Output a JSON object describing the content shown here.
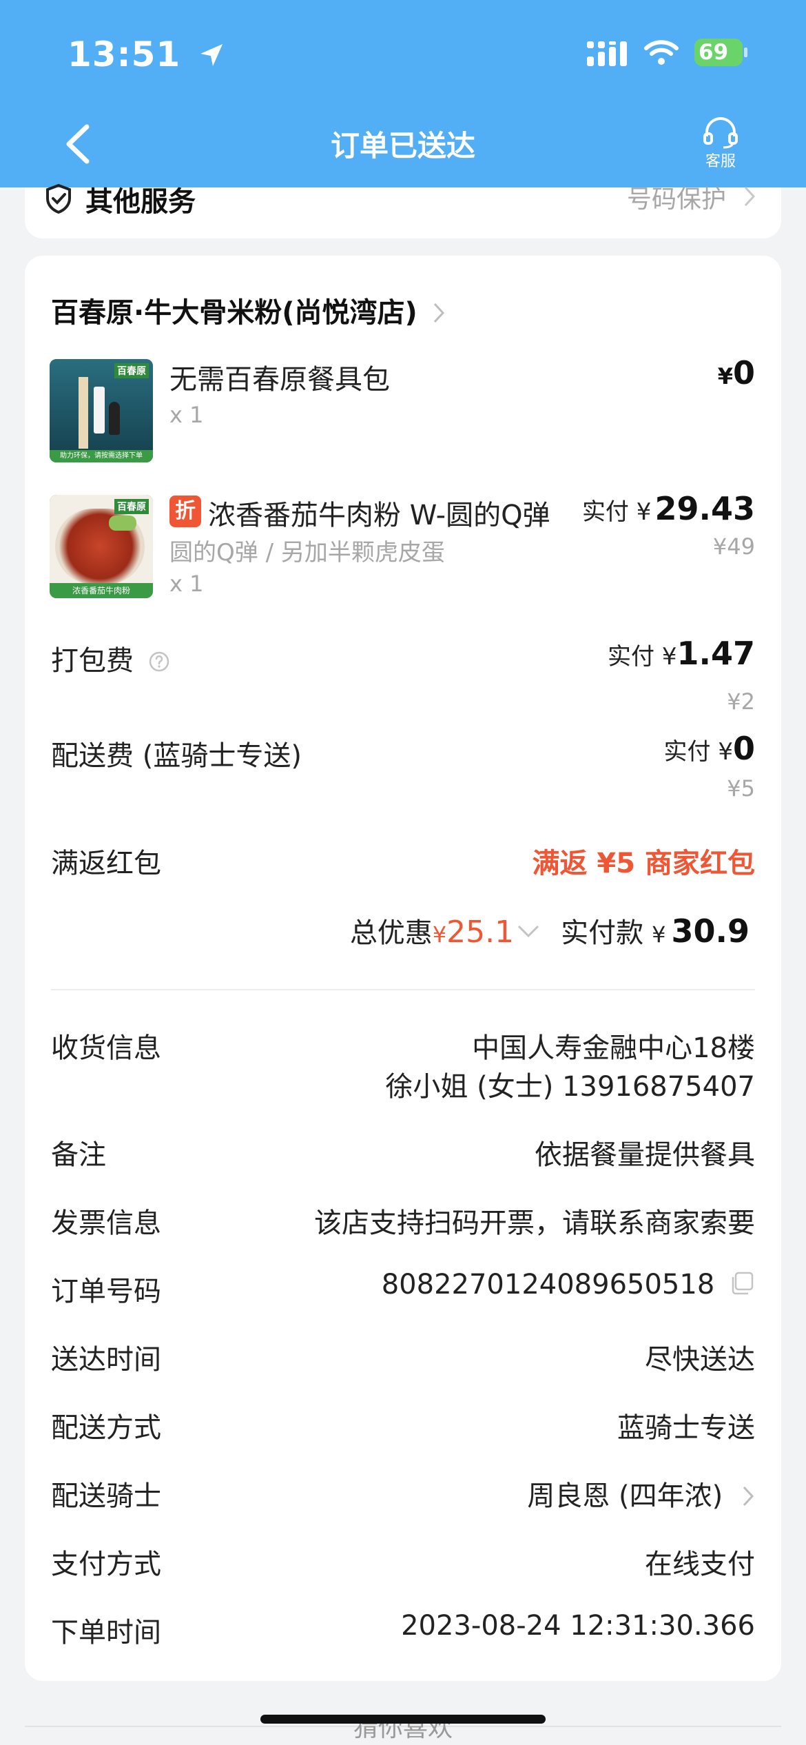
{
  "status": {
    "time": "13:51",
    "battery": "69"
  },
  "nav": {
    "title": "订单已送达",
    "service_label": "客服"
  },
  "other_services": {
    "label": "其他服务",
    "value": "号码保护"
  },
  "store": {
    "name": "百春原·牛大骨米粉(尚悦湾店)"
  },
  "items": [
    {
      "name": "无需百春原餐具包",
      "qty": "x 1",
      "price_symbol": "¥",
      "price": "0",
      "thumb_brand": "百春原",
      "thumb_caption": "助力环保，请按需选择下单"
    },
    {
      "badge": "折",
      "name": "浓香番茄牛肉粉 W-圆的Q弹",
      "spec": "圆的Q弹 / 另加半颗虎皮蛋",
      "qty": "x 1",
      "paid_prefix": "实付 ¥",
      "price": "29.43",
      "original": "¥49",
      "thumb_brand": "百春原",
      "thumb_caption": "浓香番茄牛肉粉"
    }
  ],
  "fees": {
    "packing": {
      "label": "打包费",
      "paid_prefix": "实付 ¥",
      "paid": "1.47",
      "original": "¥2"
    },
    "delivery": {
      "label": "配送费 (蓝骑士专送)",
      "paid_prefix": "实付 ¥",
      "paid": "0",
      "original": "¥5"
    },
    "redpack": {
      "label": "满返红包",
      "value": "满返 ¥5 商家红包"
    }
  },
  "totals": {
    "discount_label": "总优惠",
    "discount_symbol": "¥",
    "discount": "25.1",
    "paid_label": "实付款",
    "paid_symbol": "¥",
    "paid": "30.9"
  },
  "info": {
    "address": {
      "label": "收货信息",
      "line1": "中国人寿金融中心18楼",
      "line2": "徐小姐 (女士) 13916875407"
    },
    "note": {
      "label": "备注",
      "value": "依据餐量提供餐具"
    },
    "invoice": {
      "label": "发票信息",
      "value": "该店支持扫码开票，请联系商家索要"
    },
    "order_no": {
      "label": "订单号码",
      "value": "8082270124089650518"
    },
    "arrival": {
      "label": "送达时间",
      "value": "尽快送达"
    },
    "method": {
      "label": "配送方式",
      "value": "蓝骑士专送"
    },
    "rider": {
      "label": "配送骑士",
      "value": "周良恩 (四年浓)"
    },
    "payment": {
      "label": "支付方式",
      "value": "在线支付"
    },
    "order_time": {
      "label": "下单时间",
      "value": "2023-08-24 12:31:30.366"
    }
  },
  "footer": {
    "guess": "猜你喜欢"
  },
  "colors": {
    "header": "#52aef5",
    "accent_red": "#f05634",
    "battery": "#6ad36a"
  }
}
